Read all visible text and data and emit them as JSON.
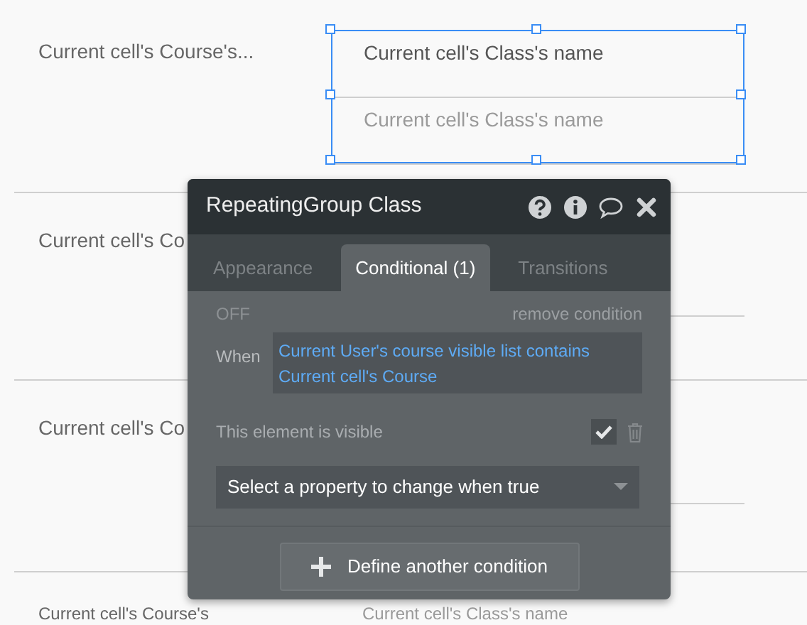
{
  "canvas": {
    "rows": [
      {
        "label": "Current cell's Course's...",
        "selected": true,
        "cells": [
          {
            "text": "Current cell's Class's name",
            "dimmed": false
          },
          {
            "text": "Current cell's Class's name",
            "dimmed": true
          }
        ]
      },
      {
        "label": "Current cell's Co",
        "selected": false,
        "cells": []
      },
      {
        "label": "Current cell's Co",
        "selected": false,
        "cells": []
      },
      {
        "label": "Current cell's Course's",
        "selected": false,
        "cells": [
          {
            "text": "Current cell's Class's name",
            "dimmed": true
          }
        ]
      }
    ]
  },
  "panel": {
    "title": "RepeatingGroup Class",
    "tabs": [
      {
        "label": "Appearance",
        "selected": false
      },
      {
        "label": "Conditional (1)",
        "selected": true
      },
      {
        "label": "Transitions",
        "selected": false
      }
    ],
    "condition": {
      "status": "OFF",
      "remove": "remove condition",
      "when_label": "When",
      "expression": "Current User's course visible list contains Current cell's Course",
      "property": {
        "label": "This element is visible",
        "checked": true
      },
      "select": {
        "placeholder": "Select a property to change when true"
      }
    },
    "add_button": "Define another condition"
  }
}
